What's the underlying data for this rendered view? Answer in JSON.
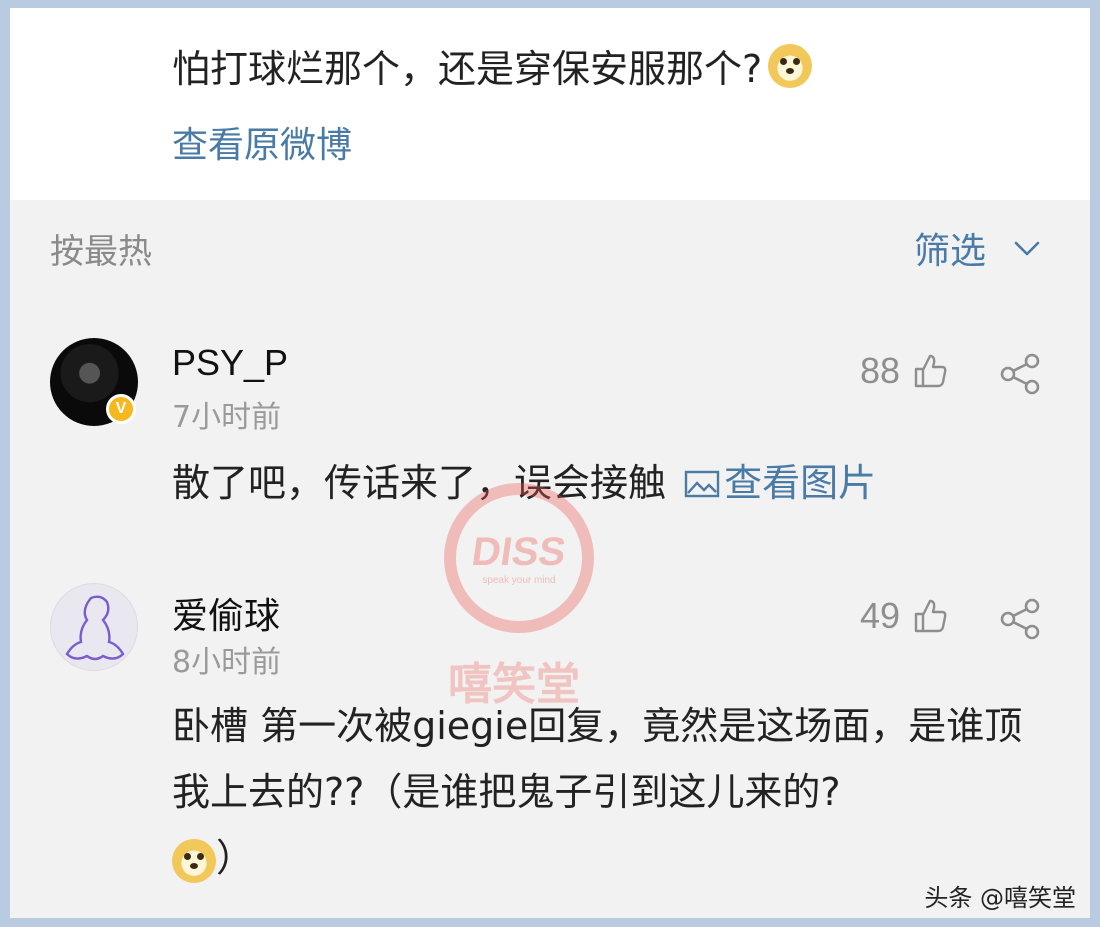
{
  "post": {
    "text": "怕打球烂那个，还是穿保安服那个?",
    "emoji": "doge-emoji",
    "view_original": "查看原微博"
  },
  "sort": {
    "label": "按最热",
    "filter_label": "筛选"
  },
  "comments": [
    {
      "username": "PSY_P",
      "time": "7小时前",
      "likes": "88",
      "verified": true,
      "text": "散了吧，传话来了，误会接触",
      "image_link": "查看图片"
    },
    {
      "username": "爱偷球",
      "time": "8小时前",
      "likes": "49",
      "verified": false,
      "text": "卧槽 第一次被giegie回复，竟然是这场面，是谁顶我上去的??（是谁把鬼子引到这儿来的?",
      "text_tail": "）"
    }
  ],
  "watermark": {
    "logo": "DISS",
    "tagline": "speak your mind",
    "name": "嘻笑堂"
  },
  "footer": {
    "source": "头条 @嘻笑堂"
  },
  "colors": {
    "link": "#4a7aa6",
    "background": "#f2f2f2",
    "border": "#b9cbe0",
    "badge": "#f6b81e"
  }
}
